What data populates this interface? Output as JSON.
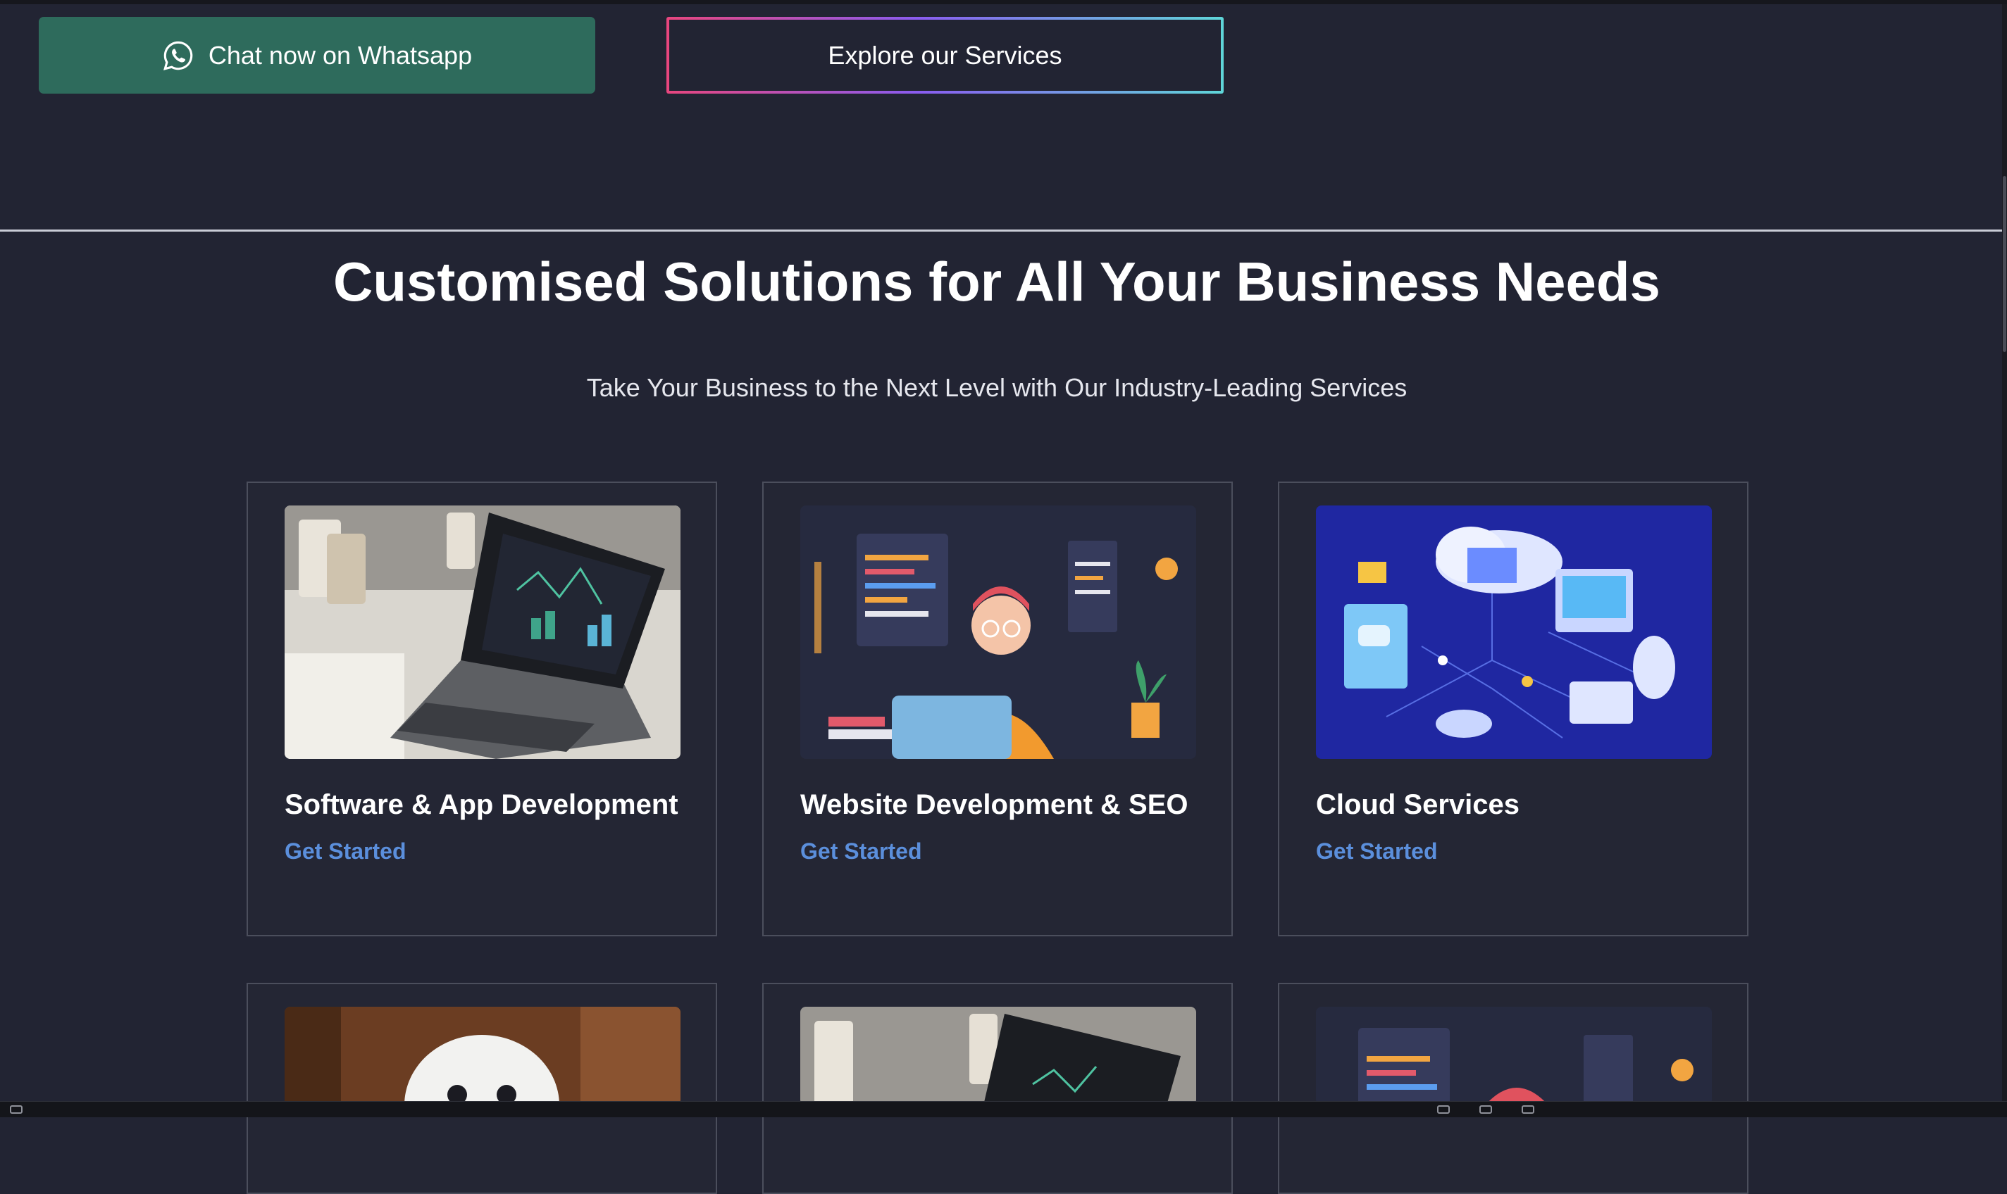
{
  "hero_buttons": {
    "whatsapp_label": "Chat now on Whatsapp",
    "whatsapp_icon": "whatsapp-icon",
    "explore_label": "Explore our Services"
  },
  "section": {
    "title": "Customised Solutions for All Your Business Needs",
    "subtitle": "Take Your Business to the Next Level with Our Industry-Leading Services"
  },
  "services": [
    {
      "title": "Software & App Development",
      "cta": "Get Started",
      "image": "laptop-dashboard-photo"
    },
    {
      "title": "Website Development & SEO",
      "cta": "Get Started",
      "image": "web-developer-illustration"
    },
    {
      "title": "Cloud Services",
      "cta": "Get Started",
      "image": "cloud-network-illustration"
    }
  ],
  "services_row2_images": [
    "robot-photo",
    "laptop-dashboard-photo",
    "web-developer-illustration"
  ],
  "colors": {
    "background": "#222433",
    "whatsapp_button": "#2e6b5c",
    "link": "#5b8fdc",
    "card_border": "#4b4e5c"
  }
}
